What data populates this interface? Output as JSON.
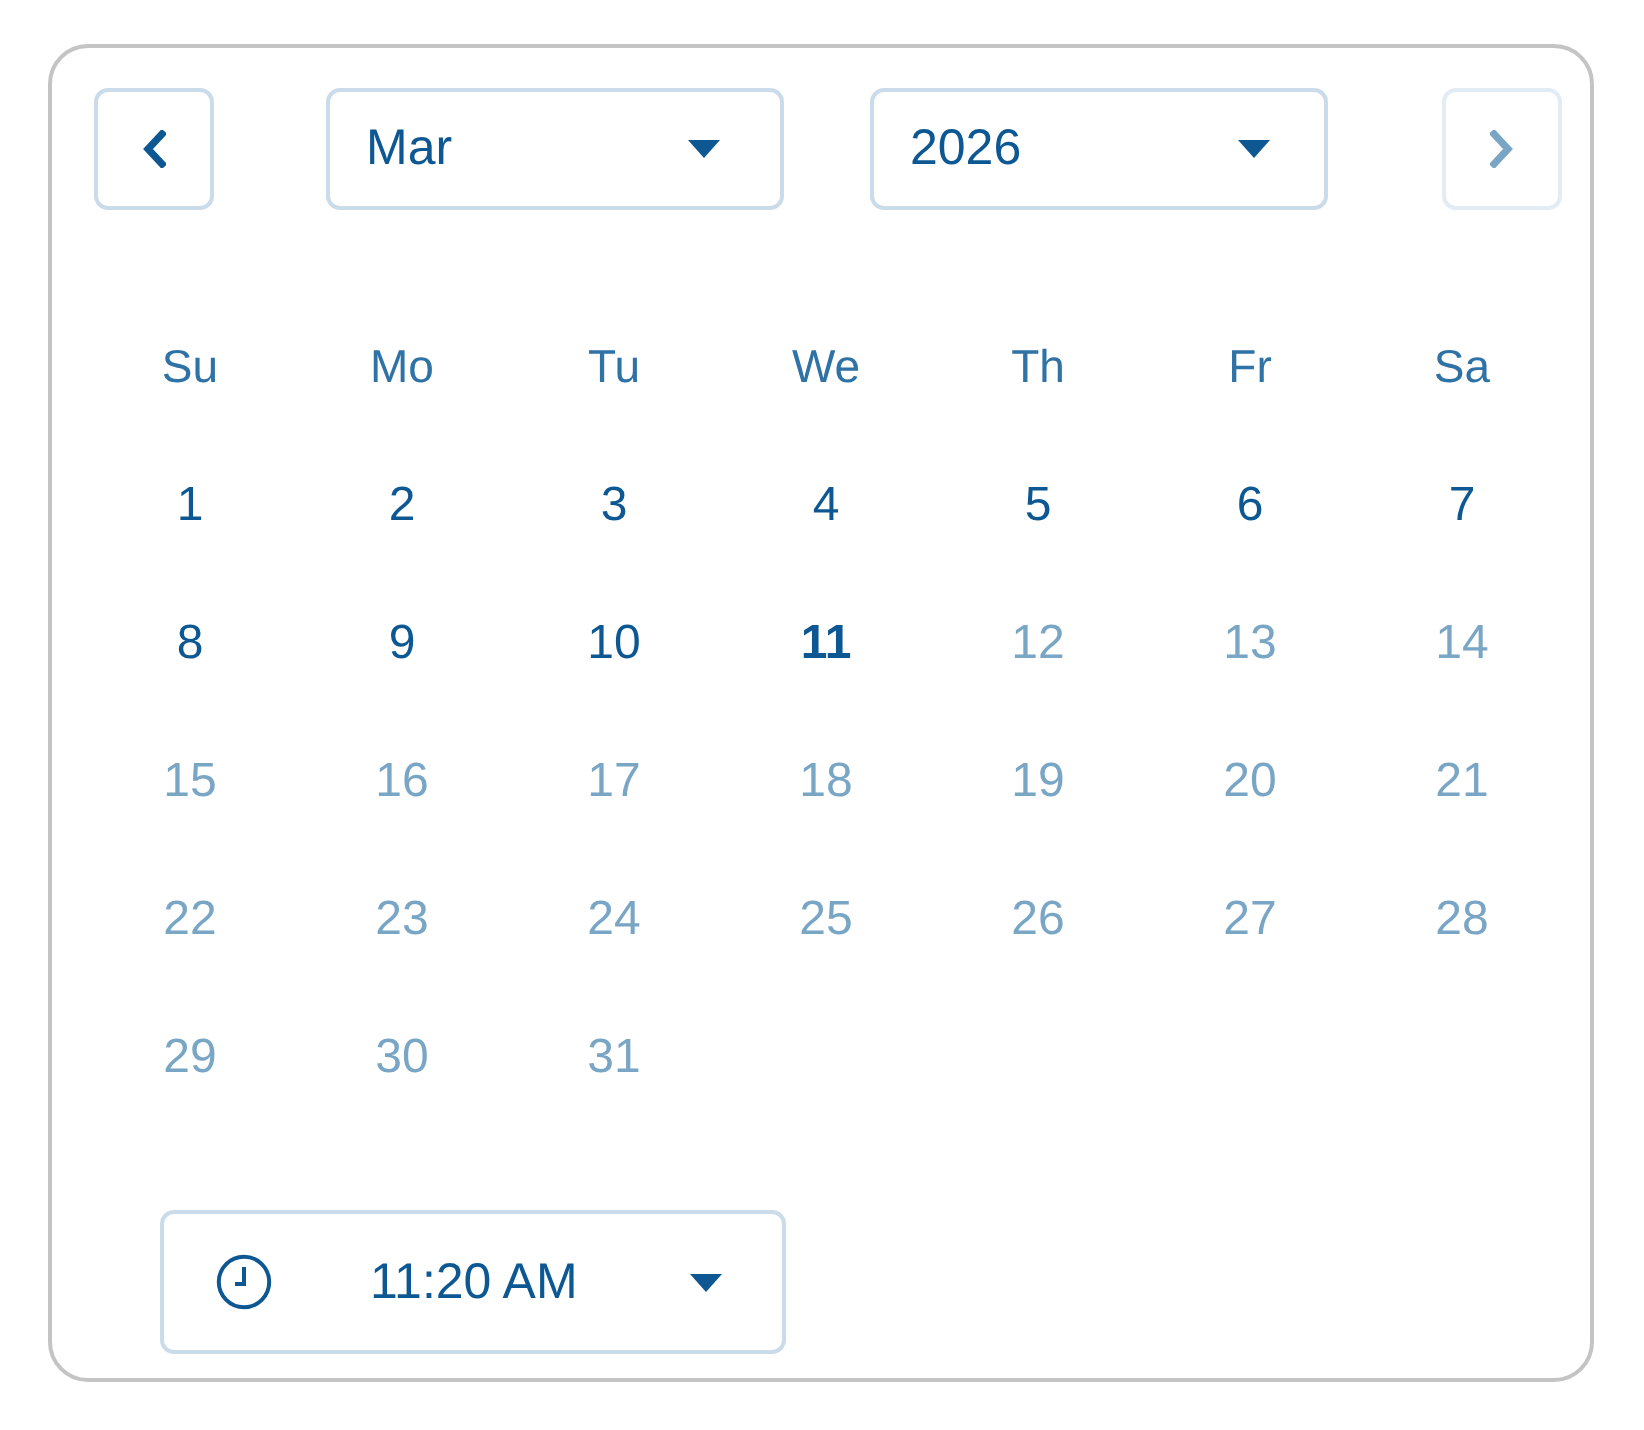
{
  "navigation": {
    "previous": {
      "disabled": false
    },
    "next": {
      "disabled": true
    }
  },
  "month_select": {
    "value": "Mar"
  },
  "year_select": {
    "value": "2026"
  },
  "weekdays": [
    "Su",
    "Mo",
    "Tu",
    "We",
    "Th",
    "Fr",
    "Sa"
  ],
  "days": [
    {
      "label": "1",
      "disabled": false,
      "today": false
    },
    {
      "label": "2",
      "disabled": false,
      "today": false
    },
    {
      "label": "3",
      "disabled": false,
      "today": false
    },
    {
      "label": "4",
      "disabled": false,
      "today": false
    },
    {
      "label": "5",
      "disabled": false,
      "today": false
    },
    {
      "label": "6",
      "disabled": false,
      "today": false
    },
    {
      "label": "7",
      "disabled": false,
      "today": false
    },
    {
      "label": "8",
      "disabled": false,
      "today": false
    },
    {
      "label": "9",
      "disabled": false,
      "today": false
    },
    {
      "label": "10",
      "disabled": false,
      "today": false
    },
    {
      "label": "11",
      "disabled": false,
      "today": true
    },
    {
      "label": "12",
      "disabled": true,
      "today": false
    },
    {
      "label": "13",
      "disabled": true,
      "today": false
    },
    {
      "label": "14",
      "disabled": true,
      "today": false
    },
    {
      "label": "15",
      "disabled": true,
      "today": false
    },
    {
      "label": "16",
      "disabled": true,
      "today": false
    },
    {
      "label": "17",
      "disabled": true,
      "today": false
    },
    {
      "label": "18",
      "disabled": true,
      "today": false
    },
    {
      "label": "19",
      "disabled": true,
      "today": false
    },
    {
      "label": "20",
      "disabled": true,
      "today": false
    },
    {
      "label": "21",
      "disabled": true,
      "today": false
    },
    {
      "label": "22",
      "disabled": true,
      "today": false
    },
    {
      "label": "23",
      "disabled": true,
      "today": false
    },
    {
      "label": "24",
      "disabled": true,
      "today": false
    },
    {
      "label": "25",
      "disabled": true,
      "today": false
    },
    {
      "label": "26",
      "disabled": true,
      "today": false
    },
    {
      "label": "27",
      "disabled": true,
      "today": false
    },
    {
      "label": "28",
      "disabled": true,
      "today": false
    },
    {
      "label": "29",
      "disabled": true,
      "today": false
    },
    {
      "label": "30",
      "disabled": true,
      "today": false
    },
    {
      "label": "31",
      "disabled": true,
      "today": false
    }
  ],
  "time_select": {
    "value": "11:20 AM"
  }
}
